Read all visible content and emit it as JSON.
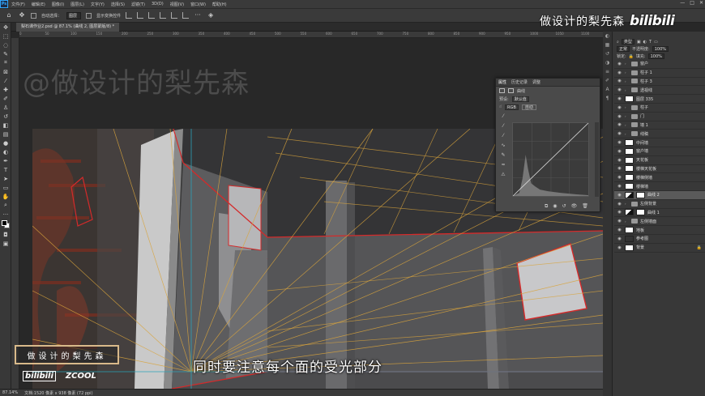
{
  "app": {
    "logo": "Ps"
  },
  "menu": [
    "文件(F)",
    "编辑(E)",
    "图像(I)",
    "图层(L)",
    "文字(Y)",
    "选择(S)",
    "滤镜(T)",
    "3D(D)",
    "视图(V)",
    "窗口(W)",
    "帮助(H)"
  ],
  "window_controls": [
    "—",
    "□",
    "✕"
  ],
  "options": {
    "auto_select_label": "自动选择：",
    "auto_select_value": "图层",
    "show_transform_label": "显示变换控件"
  },
  "watermark": {
    "text": "做设计的梨先森",
    "logo": "bilibili"
  },
  "tab": {
    "title": "梨石课作业2.psd @ 87.1% (曲线 2, 图层蒙版/8) *"
  },
  "ruler_ticks": [
    "0",
    "50",
    "100",
    "150",
    "200",
    "250",
    "300",
    "350",
    "400",
    "450",
    "500",
    "550",
    "600",
    "650",
    "700",
    "750",
    "800",
    "850",
    "900",
    "950",
    "1000",
    "1050",
    "1100"
  ],
  "canvas": {
    "big_watermark": "@做设计的梨先森",
    "brand_box": "做设计的梨先森",
    "logo_left": "bilibili",
    "logo_right": "ZCOOL"
  },
  "subtitle": "同时要注意每个面的受光部分",
  "status": {
    "zoom": "87.14%",
    "doc": "文档:1520 像素 x 938 像素 (72 ppi)"
  },
  "curves_panel": {
    "tabs": [
      "属性",
      "历史记录",
      "调整"
    ],
    "type_label": "曲线",
    "preset_label": "预设:",
    "preset_value": "默认值",
    "channel": "RGB",
    "auto_button": "自动"
  },
  "layers_panel": {
    "filter_label": "类型",
    "blend_mode": "正常",
    "opacity_label": "不透明度:",
    "opacity_value": "100%",
    "lock_label": "锁定:",
    "fill_label": "填充:",
    "fill_value": "100%",
    "layers": [
      {
        "name": "窗户",
        "kind": "folder",
        "selected": false
      },
      {
        "name": "柱子 1",
        "kind": "folder",
        "selected": false
      },
      {
        "name": "柱子 3",
        "kind": "folder",
        "selected": false
      },
      {
        "name": "透视线",
        "kind": "folder",
        "selected": false
      },
      {
        "name": "图层 335",
        "kind": "layer",
        "selected": false
      },
      {
        "name": "柱子",
        "kind": "folder",
        "selected": false
      },
      {
        "name": "门",
        "kind": "folder",
        "selected": false
      },
      {
        "name": "墙 1",
        "kind": "folder",
        "selected": false
      },
      {
        "name": "线稿",
        "kind": "folder",
        "selected": false
      },
      {
        "name": "中间墙",
        "kind": "layer",
        "selected": false
      },
      {
        "name": "窗户墙",
        "kind": "layer",
        "selected": false
      },
      {
        "name": "天花板",
        "kind": "layer",
        "selected": false
      },
      {
        "name": "楼梯天花板",
        "kind": "layer",
        "selected": false
      },
      {
        "name": "楼梯侧墙",
        "kind": "layer",
        "selected": false
      },
      {
        "name": "楼梯墙",
        "kind": "layer",
        "selected": false
      },
      {
        "name": "曲线 2",
        "kind": "adjust",
        "selected": true
      },
      {
        "name": "左侧背景",
        "kind": "folder",
        "selected": false
      },
      {
        "name": "曲线 1",
        "kind": "adjust",
        "selected": false
      },
      {
        "name": "左侧墙面",
        "kind": "folder",
        "selected": false
      },
      {
        "name": "地板",
        "kind": "layer",
        "selected": false
      },
      {
        "name": "参考图",
        "kind": "dark",
        "selected": false
      },
      {
        "name": "背景",
        "kind": "layer",
        "selected": false
      }
    ]
  },
  "colors": {
    "wall_outline": "#d42a2a",
    "perspective_lines": "#d9a43c",
    "guide": "#2aa3b8"
  }
}
